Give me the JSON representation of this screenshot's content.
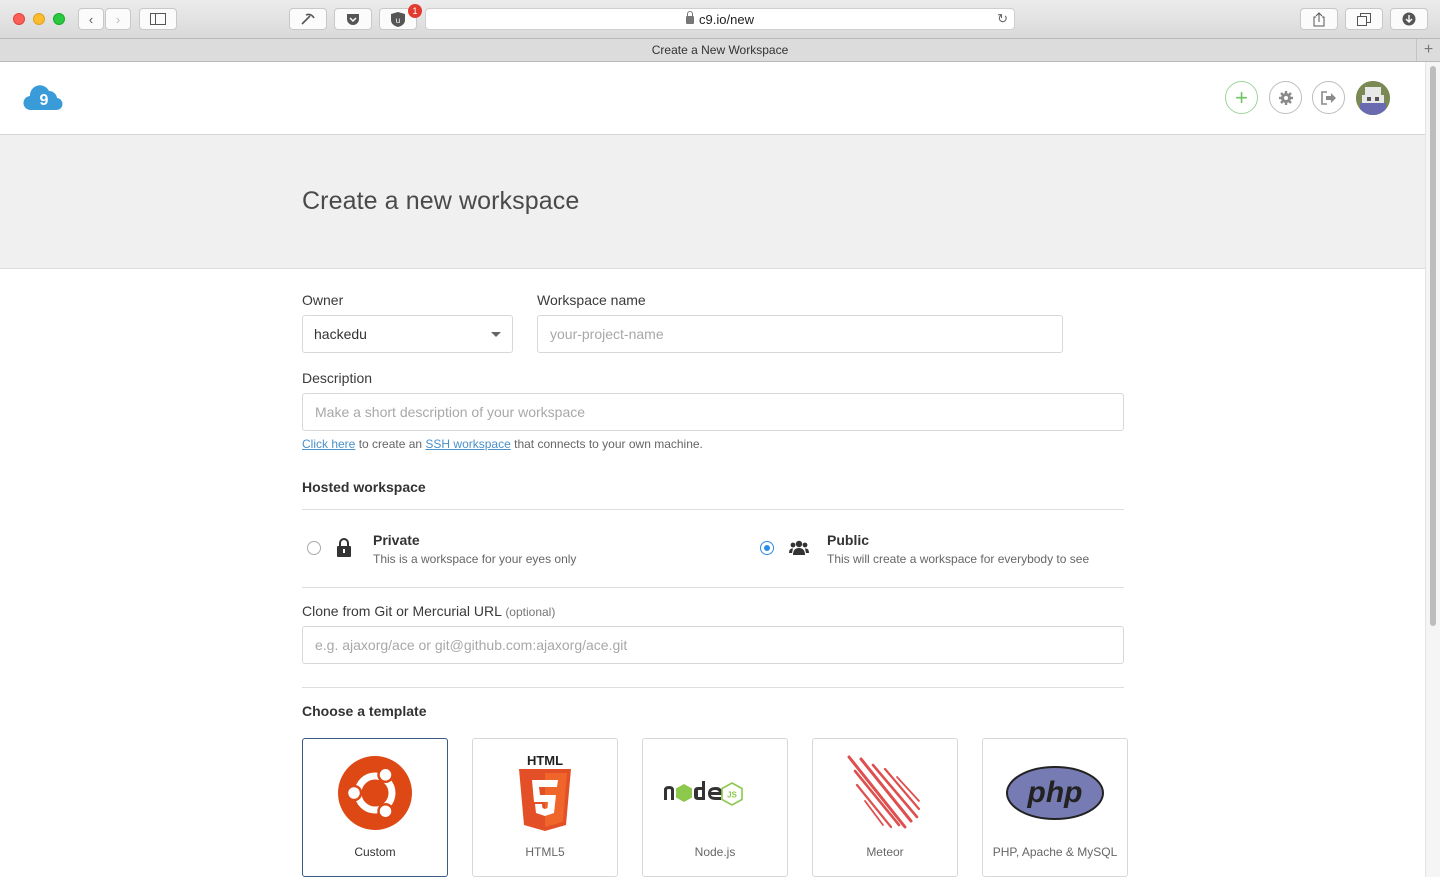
{
  "browser": {
    "url": "c9.io/new",
    "tab_title": "Create a New Workspace",
    "extension_badge": "1"
  },
  "header": {
    "logo_text": "9"
  },
  "page": {
    "title": "Create a new workspace"
  },
  "form": {
    "owner_label": "Owner",
    "owner_value": "hackedu",
    "workspace_name_label": "Workspace name",
    "workspace_name_placeholder": "your-project-name",
    "description_label": "Description",
    "description_placeholder": "Make a short description of your workspace",
    "hint": {
      "link1": "Click here",
      "text1": " to create an ",
      "link2": "SSH workspace",
      "text2": " that connects to your own machine."
    },
    "hosted_title": "Hosted workspace",
    "private": {
      "title": "Private",
      "desc": "This is a workspace for your eyes only",
      "selected": false
    },
    "public": {
      "title": "Public",
      "desc": "This will create a workspace for everybody to see",
      "selected": true
    },
    "clone_label": "Clone from Git or Mercurial URL",
    "clone_optional": "(optional)",
    "clone_placeholder": "e.g. ajaxorg/ace or git@github.com:ajaxorg/ace.git",
    "template_title": "Choose a template",
    "templates": [
      {
        "name": "Custom",
        "icon": "ubuntu-icon",
        "selected": true
      },
      {
        "name": "HTML5",
        "icon": "html5-icon",
        "selected": false
      },
      {
        "name": "Node.js",
        "icon": "nodejs-icon",
        "selected": false
      },
      {
        "name": "Meteor",
        "icon": "meteor-icon",
        "selected": false
      },
      {
        "name": "PHP, Apache & MySQL",
        "icon": "php-icon",
        "selected": false
      }
    ]
  },
  "colors": {
    "accent_blue": "#2d8ce6",
    "link_blue": "#4a90c9",
    "ubuntu_orange": "#dd4814",
    "html5_orange": "#e34f26",
    "node_green": "#8cc84b",
    "meteor_red": "#de4f4f",
    "php_purple": "#777bb3"
  }
}
